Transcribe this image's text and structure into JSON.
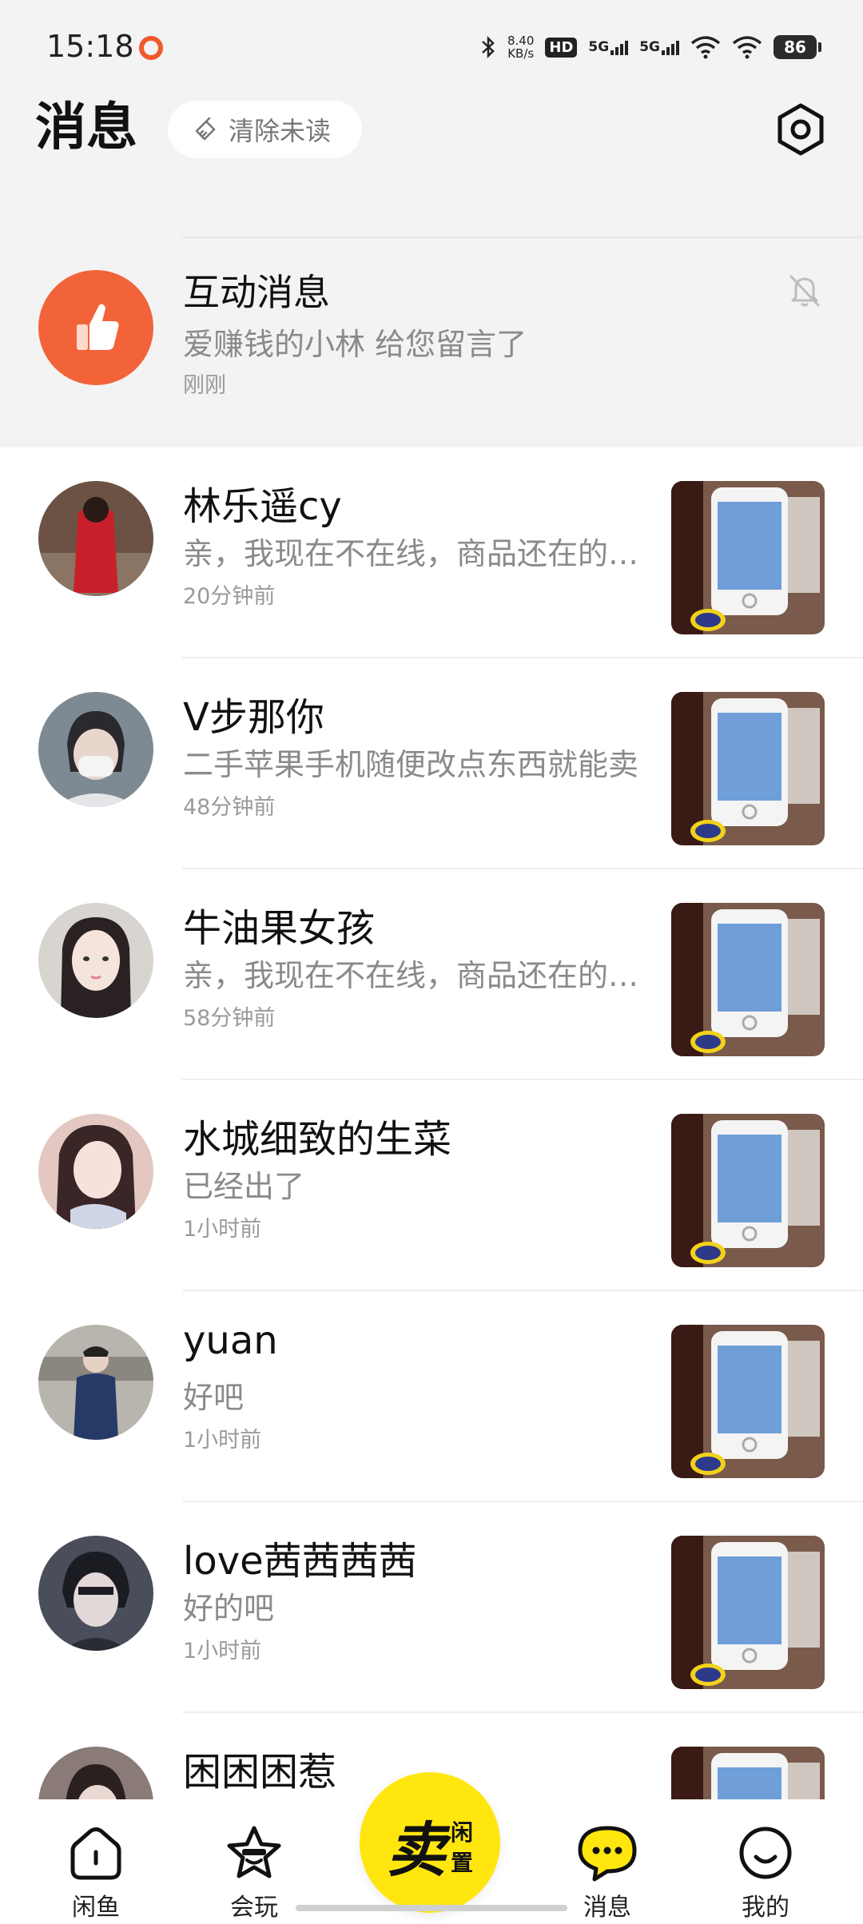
{
  "status_bar": {
    "time": "15:18",
    "net_speed_value": "8.40",
    "net_speed_unit": "KB/s",
    "hd_label": "HD",
    "sim1_label": "5G",
    "sim2_label": "5G",
    "battery": "86"
  },
  "header": {
    "title": "消息",
    "clear_unread": "清除未读"
  },
  "interaction": {
    "title": "互动消息",
    "message": "爱赚钱的小林 给您留言了",
    "time": "刚刚",
    "accent": "#f2633a"
  },
  "conversations": [
    {
      "name": "林乐遥cy",
      "message": "亲，我现在不在线，商品还在的，直接拍就行",
      "time": "20分钟前"
    },
    {
      "name": "V步那你",
      "message": "二手苹果手机随便改点东西就能卖",
      "time": "48分钟前"
    },
    {
      "name": "牛油果女孩",
      "message": "亲，我现在不在线，商品还在的，直接拍就行",
      "time": "58分钟前"
    },
    {
      "name": "水城细致的生菜",
      "message": "已经出了",
      "time": "1小时前"
    },
    {
      "name": "yuan",
      "message": "好吧",
      "time": "1小时前"
    },
    {
      "name": "love茜茜茜茜",
      "message": "好的吧",
      "time": "1小时前"
    },
    {
      "name": "困困困惹",
      "message": "",
      "time": ""
    }
  ],
  "bottom_nav": {
    "home": "闲鱼",
    "play": "会玩",
    "sell_big": "卖",
    "sell_small_1": "闲",
    "sell_small_2": "置",
    "messages": "消息",
    "me": "我的",
    "sell_color": "#ffe60f"
  }
}
